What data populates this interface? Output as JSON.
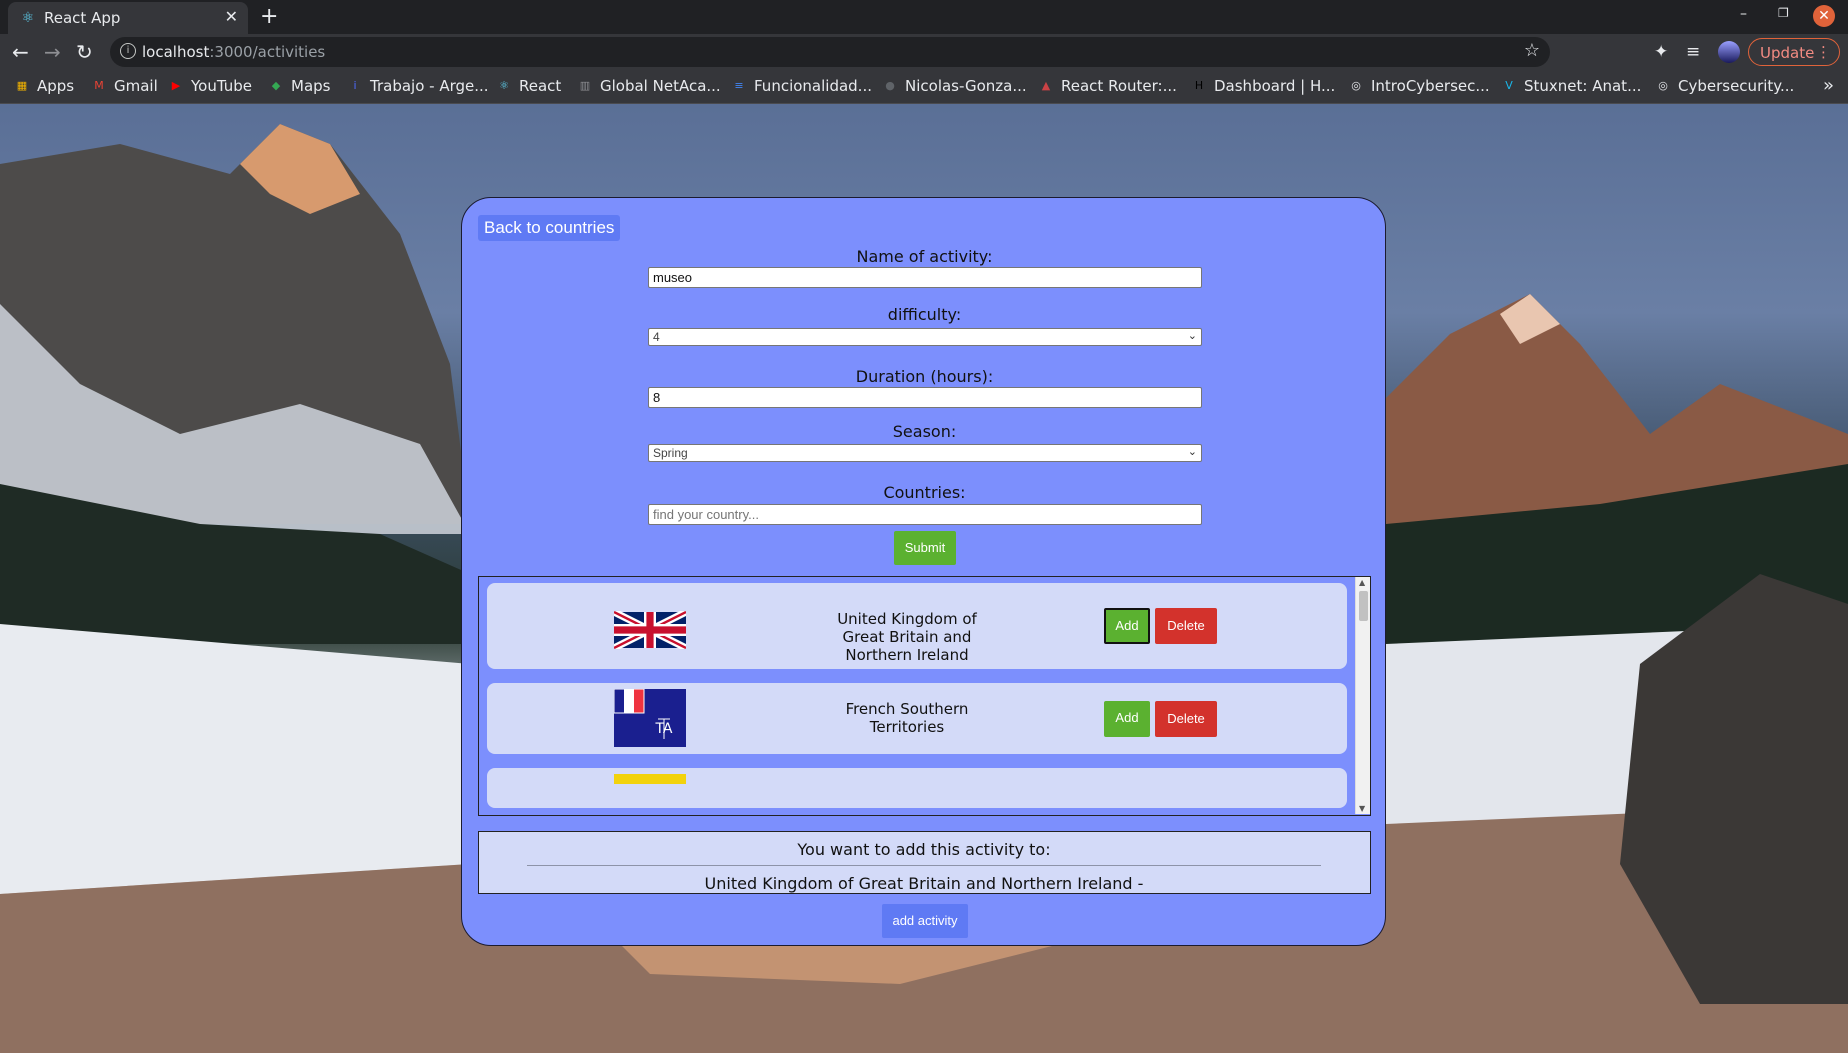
{
  "browser": {
    "tab_title": "React App",
    "new_tab": "+",
    "url_host": "localhost",
    "url_path": ":3000/activities",
    "update_label": "Update",
    "bookmarks": [
      {
        "label": "Apps",
        "icon": "apps-grid-icon",
        "color": "#f4b400"
      },
      {
        "label": "Gmail",
        "icon": "gmail-icon",
        "color": "#ea4335"
      },
      {
        "label": "YouTube",
        "icon": "youtube-icon",
        "color": "#ff0000"
      },
      {
        "label": "Maps",
        "icon": "maps-icon",
        "color": "#34a853"
      },
      {
        "label": "Trabajo - Arge...",
        "icon": "info-icon",
        "color": "#4f6bff"
      },
      {
        "label": "React",
        "icon": "react-icon",
        "color": "#61dafb"
      },
      {
        "label": "Global NetAca...",
        "icon": "cisco-icon",
        "color": "#8e8f93"
      },
      {
        "label": "Funcionalidad...",
        "icon": "docs-icon",
        "color": "#4285f4"
      },
      {
        "label": "Nicolas-Gonza...",
        "icon": "github-icon",
        "color": "#5f6368"
      },
      {
        "label": "React Router:...",
        "icon": "react-router-icon",
        "color": "#ca4245"
      },
      {
        "label": "Dashboard | H...",
        "icon": "henry-icon",
        "color": "#000000"
      },
      {
        "label": "IntroCybersec...",
        "icon": "globe-icon",
        "color": "#e8eaed"
      },
      {
        "label": "Stuxnet: Anat...",
        "icon": "vimeo-icon",
        "color": "#1ab7ea"
      },
      {
        "label": "Cybersecurity...",
        "icon": "globe-icon",
        "color": "#e8eaed"
      }
    ]
  },
  "app": {
    "back_label": "Back to countries",
    "form": {
      "name_label": "Name of activity:",
      "name_value": "museo",
      "difficulty_label": "difficulty:",
      "difficulty_value": "4",
      "duration_label": "Duration (hours):",
      "duration_value": "8",
      "season_label": "Season:",
      "season_value": "Spring",
      "countries_label": "Countries:",
      "countries_placeholder": "find your country...",
      "submit_label": "Submit"
    },
    "countries": [
      {
        "name": "United Kingdom of Great Britain and Northern Ireland",
        "flag": "uk-flag",
        "add_label": "Add",
        "delete_label": "Delete"
      },
      {
        "name": "French Southern Territories",
        "flag": "french-southern-territories-flag",
        "add_label": "Add",
        "delete_label": "Delete"
      }
    ],
    "summary": {
      "title": "You want to add this activity to:",
      "items": "United Kingdom of Great Britain and Northern Ireland -"
    },
    "add_activity_label": "add activity",
    "colors": {
      "card_bg": "#7c8ffd",
      "row_bg": "#d3daf8",
      "add_green": "#5bb130",
      "delete_red": "#d3322c",
      "accent_blue": "#5f7af4"
    }
  }
}
